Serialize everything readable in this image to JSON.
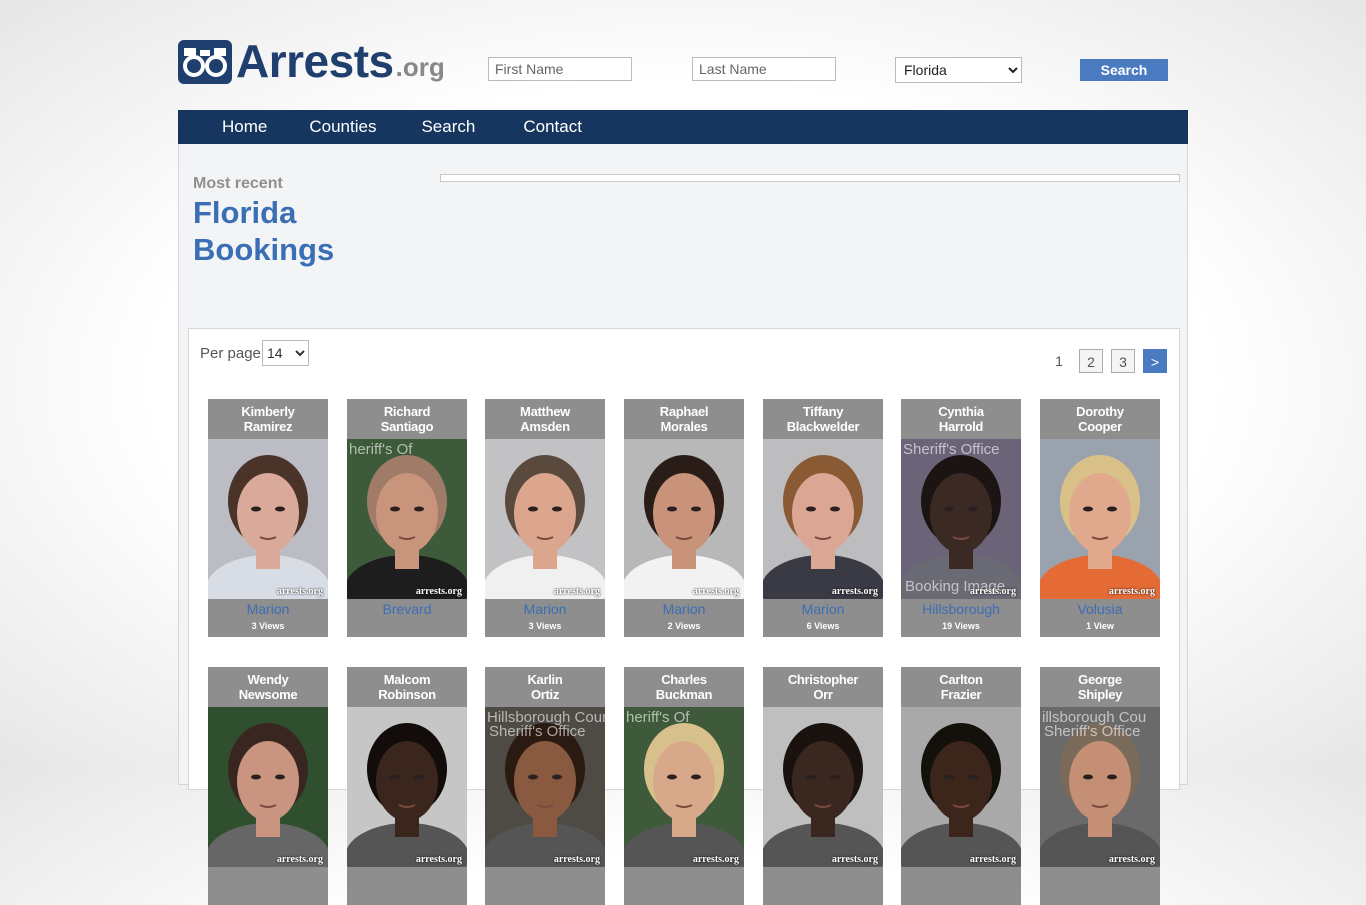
{
  "logo": {
    "text": "Arrests",
    "suffix": ".org",
    "icon": "handcuffs-logo-icon"
  },
  "search": {
    "first_name_placeholder": "First Name",
    "last_name_placeholder": "Last Name",
    "state": "Florida",
    "button_label": "Search"
  },
  "nav": {
    "home": "Home",
    "counties": "Counties",
    "search": "Search",
    "contact": "Contact"
  },
  "page": {
    "subtitle": "Most recent",
    "title_line1": "Florida",
    "title_line2": "Bookings"
  },
  "listing": {
    "per_page_label": "Per page",
    "per_page_value": "14",
    "pages": [
      "1",
      "2",
      "3"
    ],
    "current_page": "1",
    "next_label": ">"
  },
  "colors": {
    "nav_bg": "#17365f",
    "accent": "#3a6eb5",
    "button": "#4a7bc0",
    "card_bg": "#8f8e8f"
  },
  "watermark": "arrests.org",
  "bookings": [
    {
      "first": "Kimberly",
      "last": "Ramirez",
      "county": "Marion",
      "views": "3 Views",
      "bg": "#bcbcc4",
      "skin": "#d9a99a",
      "hair": "#4a3328",
      "shirt": "#d8dce4"
    },
    {
      "first": "Richard",
      "last": "Santiago",
      "county": "Brevard",
      "views": "",
      "bg": "#3d5a3a",
      "skin": "#c8957c",
      "hair": "#a07c68",
      "shirt": "#1d1d1d",
      "overlay": "heriff's Of"
    },
    {
      "first": "Matthew",
      "last": "Amsden",
      "county": "Marion",
      "views": "3 Views",
      "bg": "#c2c2c4",
      "skin": "#dba58e",
      "hair": "#5a4a3e",
      "shirt": "#f0f0f0"
    },
    {
      "first": "Raphael",
      "last": "Morales",
      "county": "Marion",
      "views": "2 Views",
      "bg": "#b8b8b8",
      "skin": "#c9937a",
      "hair": "#2a1c16",
      "shirt": "#f2f2f2"
    },
    {
      "first": "Tiffany",
      "last": "Blackwelder",
      "county": "Marion",
      "views": "6 Views",
      "bg": "#bdbdc0",
      "skin": "#dba694",
      "hair": "#8a5a34",
      "shirt": "#3a3a44"
    },
    {
      "first": "Cynthia",
      "last": "Harrold",
      "county": "Hillsborough",
      "views": "19 Views",
      "bg": "#6b6478",
      "skin": "#3b2a24",
      "hair": "#1c1412",
      "shirt": "#6a6a74",
      "overlay": "Sheriff's Office",
      "overlay2": "Booking Image"
    },
    {
      "first": "Dorothy",
      "last": "Cooper",
      "county": "Volusia",
      "views": "1 View",
      "bg": "#9aa3ad",
      "skin": "#e0a88c",
      "hair": "#d8c088",
      "shirt": "#e46a36"
    },
    {
      "first": "Wendy",
      "last": "Newsome",
      "county": "",
      "views": "",
      "bg": "#2f4f2e",
      "skin": "#c99581",
      "hair": "#3a2620",
      "shirt": "#666"
    },
    {
      "first": "Malcom",
      "last": "Robinson",
      "county": "",
      "views": "",
      "bg": "#c6c6c6",
      "skin": "#3a261c",
      "hair": "#120c0a",
      "shirt": "#555"
    },
    {
      "first": "Karlin",
      "last": "Ortiz",
      "county": "",
      "views": "",
      "bg": "#4e4a44",
      "skin": "#8a5a40",
      "hair": "#2a1a12",
      "shirt": "#555",
      "overlay": "Hillsborough Coun",
      "overlay2": "Sheriff's Office"
    },
    {
      "first": "Charles",
      "last": "Buckman",
      "county": "",
      "views": "",
      "bg": "#3f5a3b",
      "skin": "#d8a88a",
      "hair": "#d8c08c",
      "shirt": "#555",
      "overlay": "heriff's Of"
    },
    {
      "first": "Christopher",
      "last": "Orr",
      "county": "",
      "views": "",
      "bg": "#bfbfbf",
      "skin": "#3a2820",
      "hair": "#1a120e",
      "shirt": "#555"
    },
    {
      "first": "Carlton",
      "last": "Frazier",
      "county": "",
      "views": "",
      "bg": "#a9a9a9",
      "skin": "#3c261c",
      "hair": "#14100c",
      "shirt": "#555"
    },
    {
      "first": "George",
      "last": "Shipley",
      "county": "",
      "views": "",
      "bg": "#6a6a6a",
      "skin": "#c48f74",
      "hair": "#7a6a5a",
      "shirt": "#555",
      "overlay": "illsborough Cou",
      "overlay2": "Sheriff's Office"
    }
  ]
}
